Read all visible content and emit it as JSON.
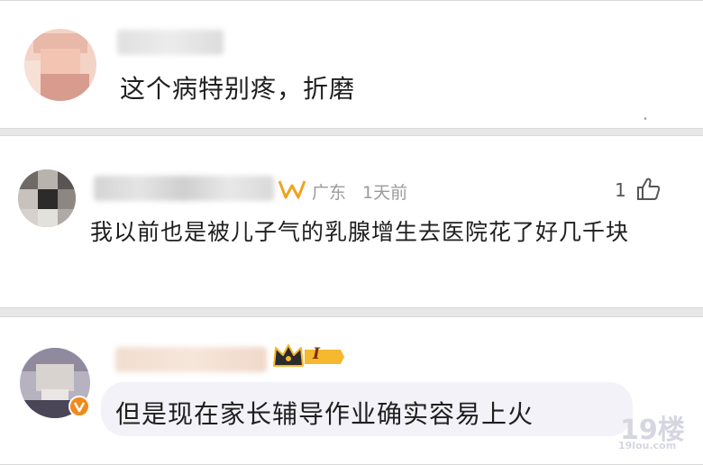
{
  "comments": [
    {
      "text": "这个病特别疼，折磨"
    },
    {
      "location": "广东",
      "time": "1天前",
      "text": "我以前也是被儿子气的乳腺增生去医院花了好几千块",
      "likes": "1"
    },
    {
      "badge": "I",
      "text": "但是现在家长辅导作业确实容易上火"
    }
  ],
  "watermark": {
    "text": "19楼",
    "sub": "19lou.com"
  },
  "colors": {
    "verified_orange": "#f08a1c",
    "badge_gold": "#f5b82e"
  }
}
